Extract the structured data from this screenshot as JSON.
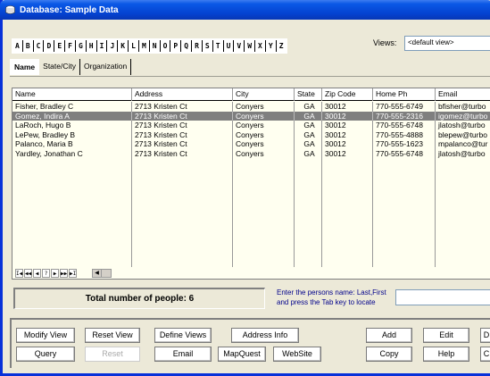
{
  "window": {
    "title": "Database: Sample Data"
  },
  "alphabet": [
    "A",
    "B",
    "C",
    "D",
    "E",
    "F",
    "G",
    "H",
    "I",
    "J",
    "K",
    "L",
    "M",
    "N",
    "O",
    "P",
    "Q",
    "R",
    "S",
    "T",
    "U",
    "V",
    "W",
    "X",
    "Y",
    "Z"
  ],
  "views": {
    "label": "Views:",
    "selected": "<default view>"
  },
  "tabs": [
    {
      "label": "Name",
      "active": true
    },
    {
      "label": "State/City",
      "active": false
    },
    {
      "label": "Organization",
      "active": false
    }
  ],
  "grid": {
    "columns": [
      "Name",
      "Address",
      "City",
      "State",
      "Zip Code",
      "Home Ph",
      "Email"
    ],
    "rows": [
      [
        "Fisher, Bradley C",
        "2713 Kristen Ct",
        "Conyers",
        "GA",
        "30012",
        "770-555-6749",
        "bfisher@turbo"
      ],
      [
        "Gomez, Indira A",
        "2713 Kristen Ct",
        "Conyers",
        "GA",
        "30012",
        "770-555-2316",
        "igomez@turbo"
      ],
      [
        "LaRoch, Hugo B",
        "2713 Kristen Ct",
        "Conyers",
        "GA",
        "30012",
        "770-555-6748",
        "jlatosh@turbo"
      ],
      [
        "LePew, Bradley B",
        "2713 Kristen Ct",
        "Conyers",
        "GA",
        "30012",
        "770-555-4888",
        "blepew@turbo"
      ],
      [
        "Palanco, Maria B",
        "2713 Kristen Ct",
        "Conyers",
        "GA",
        "30012",
        "770-555-1623",
        "mpalanco@tur"
      ],
      [
        "Yardley, Jonathan C",
        "2713 Kristen Ct",
        "Conyers",
        "GA",
        "30012",
        "770-555-6748",
        "jlatosh@turbo"
      ]
    ],
    "selected_row": 1,
    "nav": [
      "I◀",
      "◀◀",
      "◀",
      "?",
      "▶",
      "▶▶",
      "▶I"
    ]
  },
  "status": {
    "count_text": "Total number of people: 6",
    "hint_line1": "Enter the persons name: Last,First",
    "hint_line2": "and press the Tab key to locate",
    "locate_value": ""
  },
  "buttons": {
    "modify_view": "Modify View",
    "reset_view": "Reset View",
    "define_views": "Define Views",
    "address_info": "Address Info",
    "add": "Add",
    "edit": "Edit",
    "delete": "D",
    "query": "Query",
    "reset": "Reset",
    "email": "Email",
    "mapquest": "MapQuest",
    "website": "WebSite",
    "copy": "Copy",
    "help": "Help",
    "close": "C"
  }
}
